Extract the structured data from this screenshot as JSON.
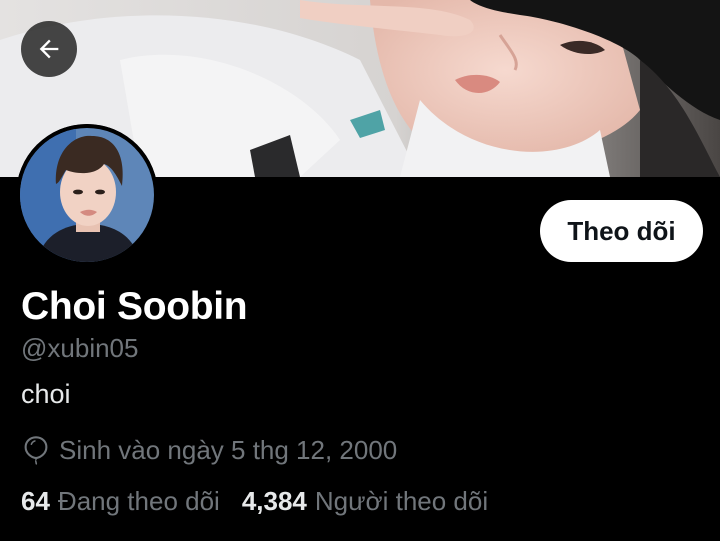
{
  "profile": {
    "display_name": "Choi Soobin",
    "handle": "@xubin05",
    "bio": "choi",
    "birthday": "Sinh vào ngày 5 thg 12, 2000"
  },
  "actions": {
    "follow_label": "Theo dõi"
  },
  "stats": {
    "following_count": "64",
    "following_label": "Đang theo dõi",
    "followers_count": "4,384",
    "followers_label": "Người theo dõi"
  },
  "icons": {
    "back": "arrow-left-icon",
    "birthday": "balloon-icon"
  },
  "colors": {
    "background": "#000000",
    "primary_text": "#e7e9ea",
    "secondary_text": "#71767b",
    "follow_button_bg": "#ffffff",
    "follow_button_text": "#0f1419"
  }
}
